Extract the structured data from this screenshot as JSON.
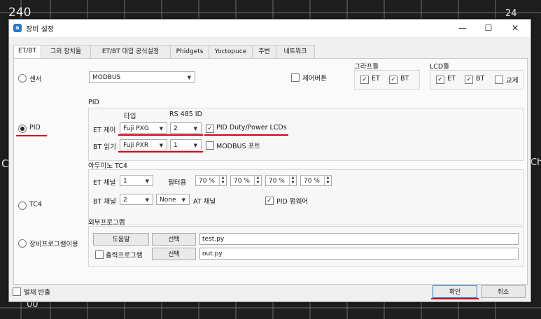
{
  "background": {
    "label_240": "240",
    "label_24": "24",
    "label_bottom_left": "00",
    "left_edge_char": "C",
    "right_edge_chars": "Chill"
  },
  "window": {
    "title": "장비 설정",
    "minimize": "—",
    "maximize": "☐",
    "close": "✕"
  },
  "tabs": [
    "ET/BT",
    "그외 장치들",
    "ET/BT 대입 공식설정",
    "Phidgets",
    "Yoctopuce",
    "주변",
    "네트워크"
  ],
  "sensor": {
    "radio_label": "센서",
    "meter_value": "MODBUS",
    "control_button_label": "제어버튼",
    "graphs_label": "그라프들",
    "graph_et": "ET",
    "graph_bt": "BT",
    "lcds_label": "LCD들",
    "lcd_et": "ET",
    "lcd_bt": "BT",
    "swap_label": "교제"
  },
  "pid": {
    "section_label": "PID",
    "radio_label": "PID",
    "type_header": "타입",
    "rs485_header": "RS 485 ID",
    "et_control_label": "ET 제어",
    "et_type": "Fuji PXG",
    "et_id": "2",
    "duty_label": "PID Duty/Power LCDs",
    "bt_read_label": "BT 읽기",
    "bt_type": "Fuji PXR",
    "bt_id": "1",
    "modbus_port_label": "MODBUS 포트"
  },
  "tc4": {
    "section_label": "아두이노 TC4",
    "radio_label": "TC4",
    "et_channel_label": "ET 채널",
    "et_channel": "1",
    "filter_label": "필터용",
    "filters": [
      "70 %",
      "70 %",
      "70 %",
      "70 %"
    ],
    "bt_channel_label": "BT 채널",
    "bt_channel": "2",
    "at_value": "None",
    "at_channel_label": "AT 채널",
    "pid_firmware_label": "PID 펌웨어"
  },
  "external": {
    "section_label": "외부프로그램",
    "radio_label": "장비프로그램이용",
    "help_button": "도움말",
    "select_button_1": "선택",
    "program_path": "test.py",
    "output_check_label": "출력프로그램",
    "select_button_2": "선택",
    "output_path": "out.py"
  },
  "footer": {
    "batch_label": "벌채 반출",
    "ok_button": "확인",
    "cancel_button": "취소"
  },
  "colors": {
    "accent_red": "#d0021b",
    "title_icon": "#1f78d1"
  }
}
